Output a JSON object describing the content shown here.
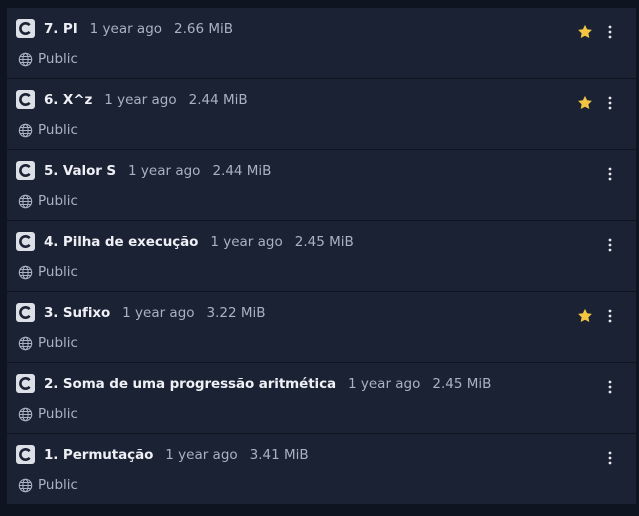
{
  "repos": [
    {
      "name": "7. PI",
      "age": "1 year ago",
      "size": "2.66 MiB",
      "visibility": "Public",
      "starred": true
    },
    {
      "name": "6. X^z",
      "age": "1 year ago",
      "size": "2.44 MiB",
      "visibility": "Public",
      "starred": true
    },
    {
      "name": "5. Valor S",
      "age": "1 year ago",
      "size": "2.44 MiB",
      "visibility": "Public",
      "starred": false
    },
    {
      "name": "4. Pilha de execução",
      "age": "1 year ago",
      "size": "2.45 MiB",
      "visibility": "Public",
      "starred": false
    },
    {
      "name": "3. Sufixo",
      "age": "1 year ago",
      "size": "3.22 MiB",
      "visibility": "Public",
      "starred": true
    },
    {
      "name": "2. Soma de uma progressão aritmética",
      "age": "1 year ago",
      "size": "2.45 MiB",
      "visibility": "Public",
      "starred": false
    },
    {
      "name": "1. Permutação",
      "age": "1 year ago",
      "size": "3.41 MiB",
      "visibility": "Public",
      "starred": false
    }
  ],
  "icons": {
    "language": "c-language-icon",
    "visibility": "globe-icon",
    "star": "star-icon",
    "menu": "kebab-menu-icon"
  },
  "colors": {
    "star": "#f5c542",
    "background": "#0f1421",
    "row_background": "#1b2234"
  }
}
